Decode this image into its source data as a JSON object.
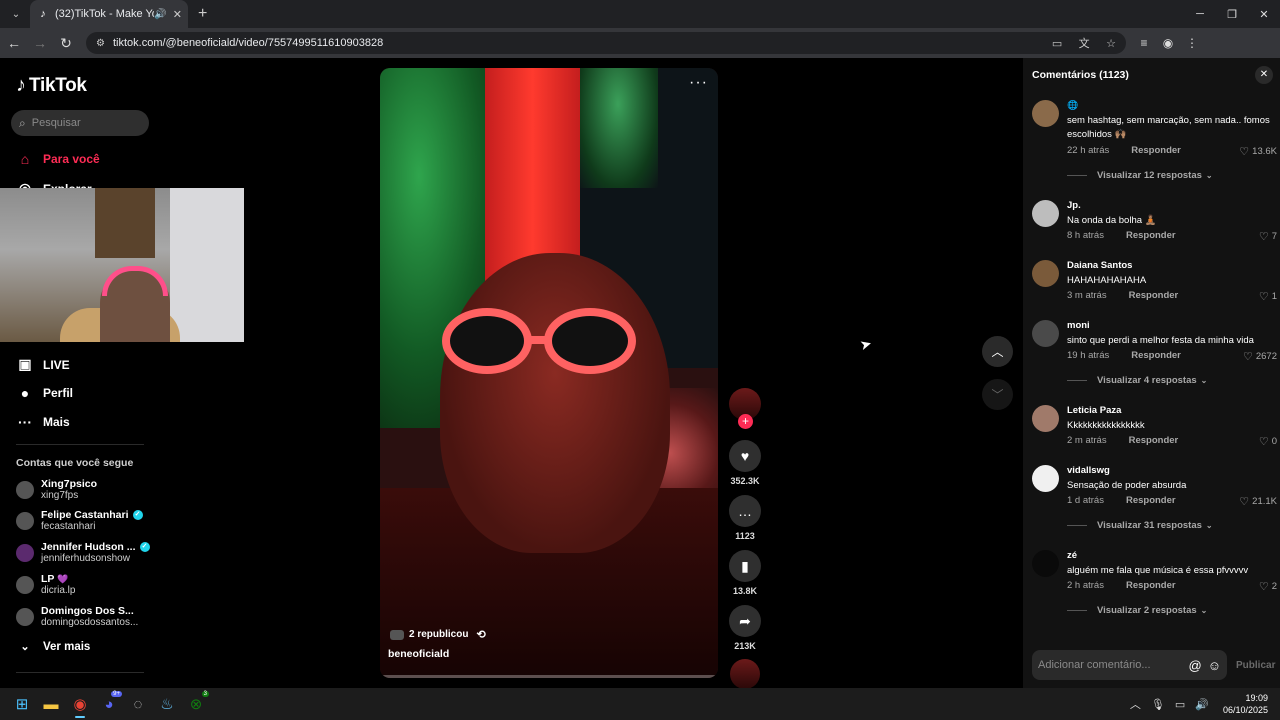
{
  "browser": {
    "tab_title": "(32)TikTok - Make Your Day",
    "url": "tiktok.com/@beneoficiald/video/7557499511610903828"
  },
  "sidebar": {
    "logo_text": "TikTok",
    "search_placeholder": "Pesquisar",
    "nav": {
      "for_you": "Para você",
      "explore": "Explorar",
      "live": "LIVE",
      "profile": "Perfil",
      "more": "Mais"
    },
    "following_title": "Contas que você segue",
    "following": [
      {
        "name": "Xing7psico",
        "handle": "xing7fps",
        "verified": false
      },
      {
        "name": "Felipe Castanhari",
        "handle": "fecastanhari",
        "verified": true
      },
      {
        "name": "Jennifer Hudson ...",
        "handle": "jenniferhudsonshow",
        "verified": true
      },
      {
        "name": "LP",
        "handle": "dicria.lp",
        "verified": false
      },
      {
        "name": "Domingos Dos S...",
        "handle": "domingosdossantos...",
        "verified": false
      }
    ],
    "see_more": "Ver mais"
  },
  "video": {
    "reposted": "2 republicou",
    "author": "beneoficiald"
  },
  "actions": {
    "likes": "352.3K",
    "comments": "1123",
    "saves": "13.8K",
    "shares": "213K"
  },
  "comments": {
    "header": "Comentários (1123)",
    "reply_label": "Responder",
    "items": [
      {
        "user": "",
        "text": "sem hashtag, sem marcação, sem nada.. fomos escolhidos 🙌🏽",
        "time": "22 h atrás",
        "likes": "13.6K",
        "replies": "Visualizar 12 respostas"
      },
      {
        "user": "Jp.",
        "text": "Na onda da bolha 🧘🏽",
        "time": "8 h atrás",
        "likes": "7",
        "replies": ""
      },
      {
        "user": "Daiana Santos",
        "text": "HAHAHAHAHAHA",
        "time": "3 m atrás",
        "likes": "1",
        "replies": ""
      },
      {
        "user": "moni",
        "text": "sinto que perdi a melhor festa da minha vida",
        "time": "19 h atrás",
        "likes": "2672",
        "replies": "Visualizar 4 respostas"
      },
      {
        "user": "Leticia Paza",
        "text": "Kkkkkkkkkkkkkkkk",
        "time": "2 m atrás",
        "likes": "0",
        "replies": ""
      },
      {
        "user": "vidallswg",
        "text": "Sensação de poder absurda",
        "time": "1 d atrás",
        "likes": "21.1K",
        "replies": "Visualizar 31 respostas"
      },
      {
        "user": "zé",
        "text": "alguém me fala que música é essa pfvvvvv",
        "time": "2 h atrás",
        "likes": "2",
        "replies": "Visualizar 2 respostas"
      }
    ],
    "input_placeholder": "Adicionar comentário...",
    "publish": "Publicar"
  },
  "taskbar": {
    "time": "19:09",
    "date": "06/10/2025",
    "discord_badge": "9+",
    "xbox_badge": "3"
  }
}
